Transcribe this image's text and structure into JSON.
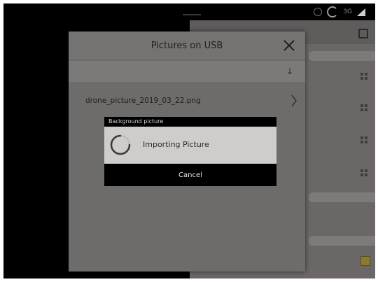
{
  "status_bar": {
    "network_label": "3G",
    "icons": [
      "circle-icon",
      "clock-icon",
      "signal-icon"
    ]
  },
  "file_dialog": {
    "title": "Pictures on USB",
    "close_icon": "close-icon",
    "sort_icon": "sort-icon",
    "sort_glyph": "↓",
    "files": [
      {
        "name": "drone_picture_2019_03_22.png"
      }
    ]
  },
  "progress_dialog": {
    "title": "Background picture",
    "message": "Importing Picture",
    "cancel_label": "Cancel",
    "spinner_icon": "spinner-icon"
  },
  "colors": {
    "overlay_dim": "#6e6b6b",
    "dialog_black": "#000000",
    "dialog_body": "#cfcdca"
  }
}
